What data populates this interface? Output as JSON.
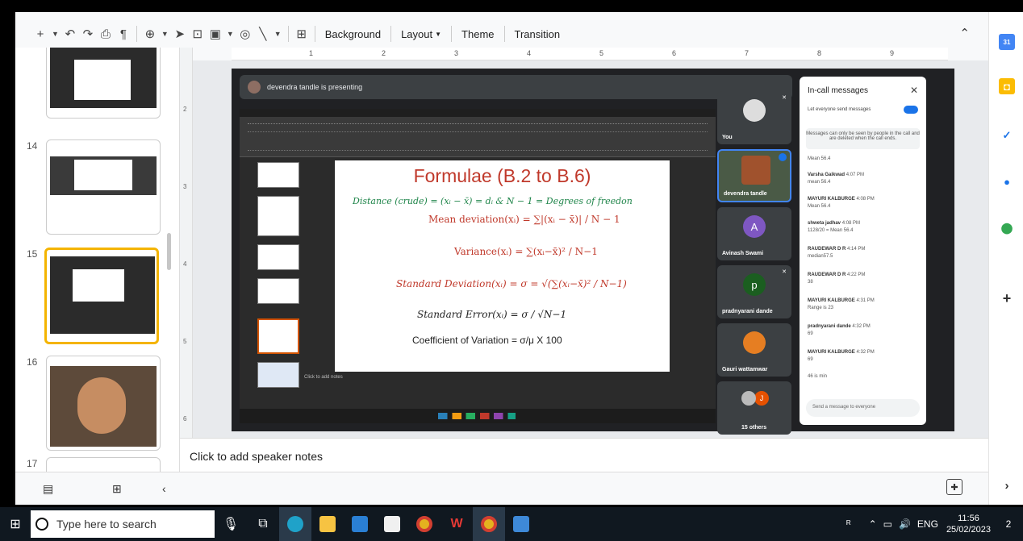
{
  "toolbar": {
    "background_label": "Background",
    "layout_label": "Layout",
    "theme_label": "Theme",
    "transition_label": "Transition"
  },
  "filmstrip": {
    "slides": [
      {
        "number": "14"
      },
      {
        "number": "15"
      },
      {
        "number": "16"
      },
      {
        "number": "17"
      }
    ]
  },
  "ruler": {
    "h": [
      "1",
      "2",
      "3",
      "4",
      "5",
      "6",
      "7",
      "8",
      "9"
    ],
    "v": [
      "2",
      "3",
      "4",
      "5",
      "6"
    ]
  },
  "meet": {
    "presenting": "devendra tandle is presenting",
    "participants": [
      {
        "name": "You",
        "avatar": ""
      },
      {
        "name": "devendra tandle",
        "avatar": ""
      },
      {
        "name": "Avinash Swami",
        "avatar": "A"
      },
      {
        "name": "pradnyarani dande",
        "avatar": "p"
      },
      {
        "name": "Gauri wattamwar",
        "avatar": ""
      },
      {
        "name": "15 others",
        "avatar": "J"
      }
    ],
    "chat": {
      "title": "In-call messages",
      "toggle_label": "Let everyone send messages",
      "info": "Messages can only be seen by people in the call and are deleted when the call ends.",
      "messages": [
        {
          "sender": "",
          "time": "",
          "text": "Mean 56.4"
        },
        {
          "sender": "Varsha Gaikwad",
          "time": "4:07 PM",
          "text": "mean 56.4"
        },
        {
          "sender": "MAYURI KALBURGE",
          "time": "4:08 PM",
          "text": "Mean 56.4"
        },
        {
          "sender": "shweta jadhav",
          "time": "4:08 PM",
          "text": "1128/20 = Mean 56.4"
        },
        {
          "sender": "RAUDEWAR D R",
          "time": "4:14 PM",
          "text": "median57.5"
        },
        {
          "sender": "RAUDEWAR D R",
          "time": "4:22 PM",
          "text": "38"
        },
        {
          "sender": "MAYURI KALBURGE",
          "time": "4:31 PM",
          "text": "Range is 23"
        },
        {
          "sender": "pradnyarani dande",
          "time": "4:32 PM",
          "text": "69"
        },
        {
          "sender": "MAYURI KALBURGE",
          "time": "4:32 PM",
          "text": "69"
        },
        {
          "sender": "",
          "time": "",
          "text": "46 is min"
        }
      ],
      "input_placeholder": "Send a message to everyone"
    }
  },
  "slide": {
    "title": "Formulae (B.2 to B.6)",
    "distance": "Distance (crude) = (xᵢ − x̄) = dᵢ & N − 1 = Degrees of freedon",
    "mean_dev": "Mean deviation(xᵢ) = ∑|(xᵢ − x̄)| / N − 1",
    "variance": "Variance(xᵢ) = ∑(xᵢ−x̄)² / N−1",
    "sd": "Standard Deviation(xᵢ) = σ = √(∑(xᵢ−x̄)² / N−1)",
    "se": "Standard Error(xᵢ) = σ / √N−1",
    "cv": "Coefficient of Variation = σ/μ X 100",
    "notes_mini": "Click to add notes"
  },
  "notes": {
    "placeholder": "Click to add speaker notes"
  },
  "taskbar": {
    "search_placeholder": "Type here to search",
    "language": "ENG",
    "time": "11:56",
    "date": "25/02/2023",
    "notifications": "2"
  },
  "colors": {
    "selection": "#f4b400",
    "meet_bg": "#202124",
    "title_red": "#c0392b",
    "formula_green": "#1e8449"
  }
}
